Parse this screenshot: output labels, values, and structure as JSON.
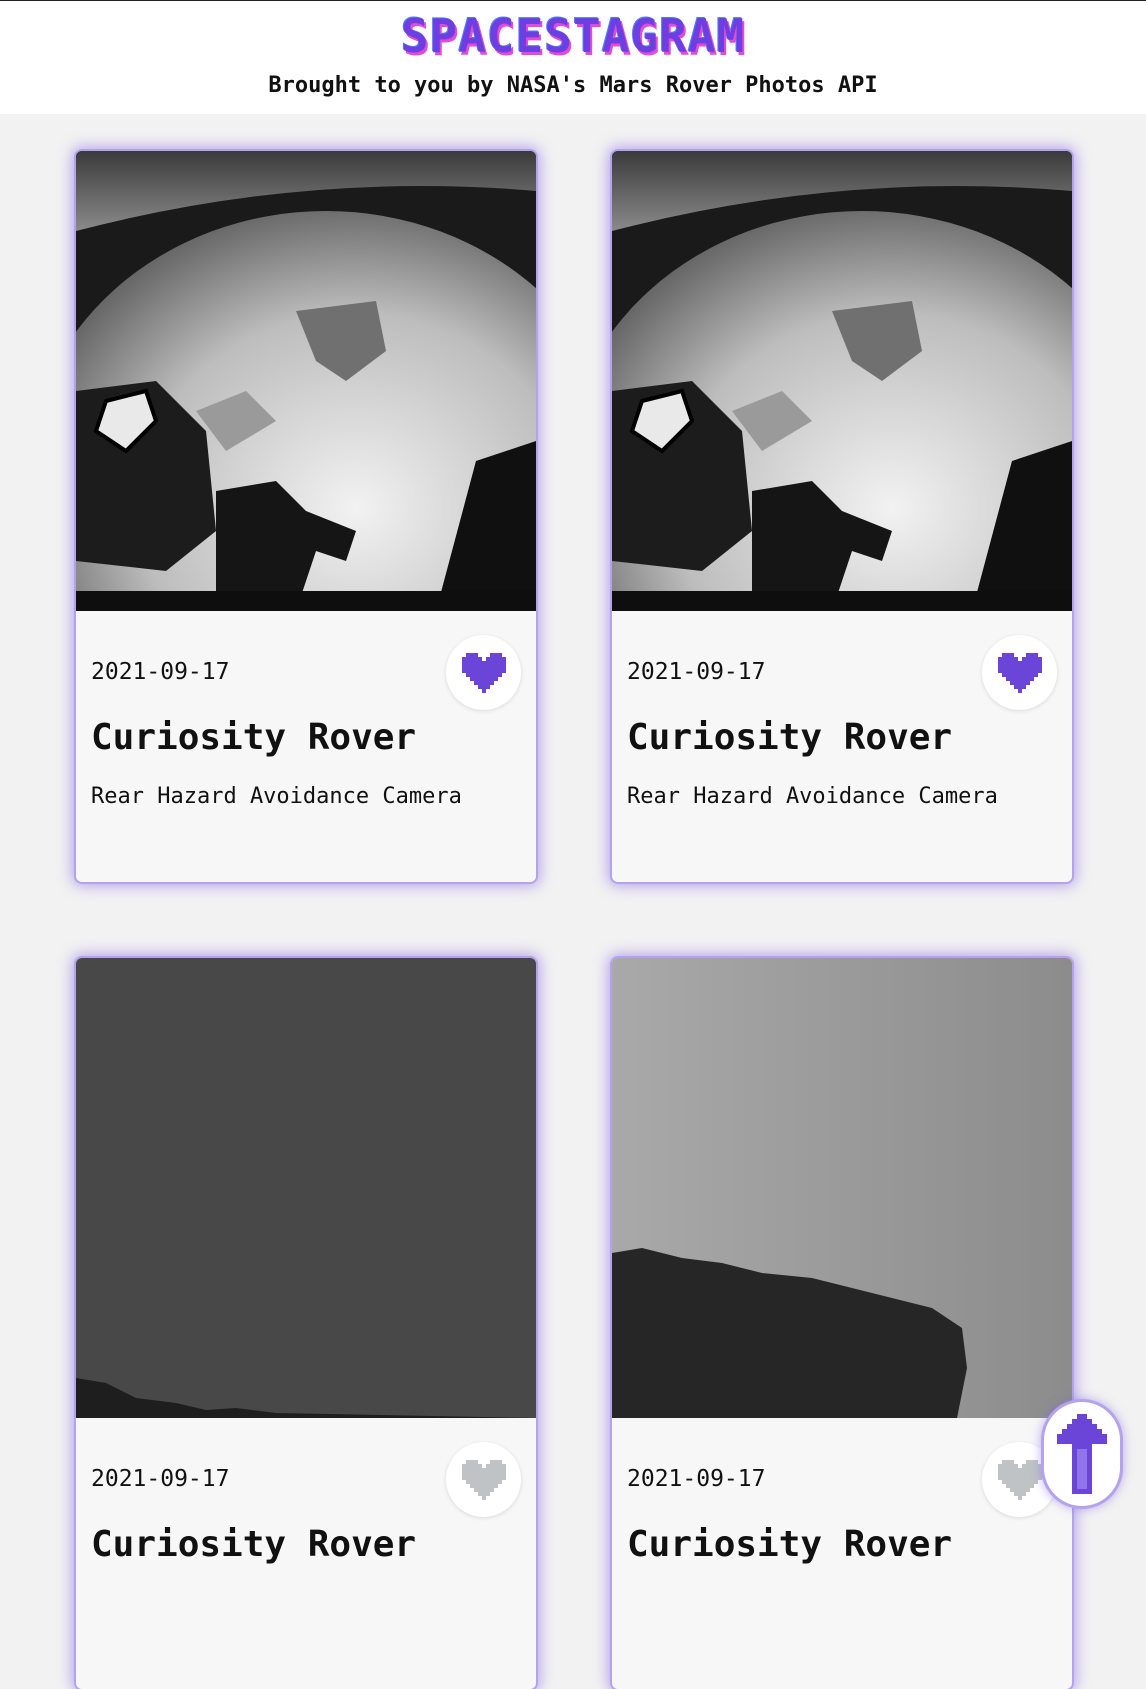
{
  "header": {
    "logo": "SPACESTAGRAM",
    "tagline": "Brought to you by NASA's Mars Rover Photos API"
  },
  "colors": {
    "accent": "#6a45d8",
    "liked_heart": "#6a45d8",
    "unliked_heart": "#bfc3c6",
    "page_background": "#f2f2f2"
  },
  "cards": [
    {
      "date": "2021-09-17",
      "rover": "Curiosity Rover",
      "camera": "Rear Hazard Avoidance Camera",
      "liked": true,
      "image": "mars-ground-with-rover-wheel"
    },
    {
      "date": "2021-09-17",
      "rover": "Curiosity Rover",
      "camera": "Rear Hazard Avoidance Camera",
      "liked": true,
      "image": "mars-ground-with-rover-wheel"
    },
    {
      "date": "2021-09-17",
      "rover": "Curiosity Rover",
      "camera": "",
      "liked": false,
      "image": "dark-sky-with-horizon"
    },
    {
      "date": "2021-09-17",
      "rover": "Curiosity Rover",
      "camera": "",
      "liked": false,
      "image": "sky-with-rock-ridge"
    }
  ],
  "icons": {
    "like": "heart-icon",
    "scroll_top": "arrow-up-icon"
  }
}
